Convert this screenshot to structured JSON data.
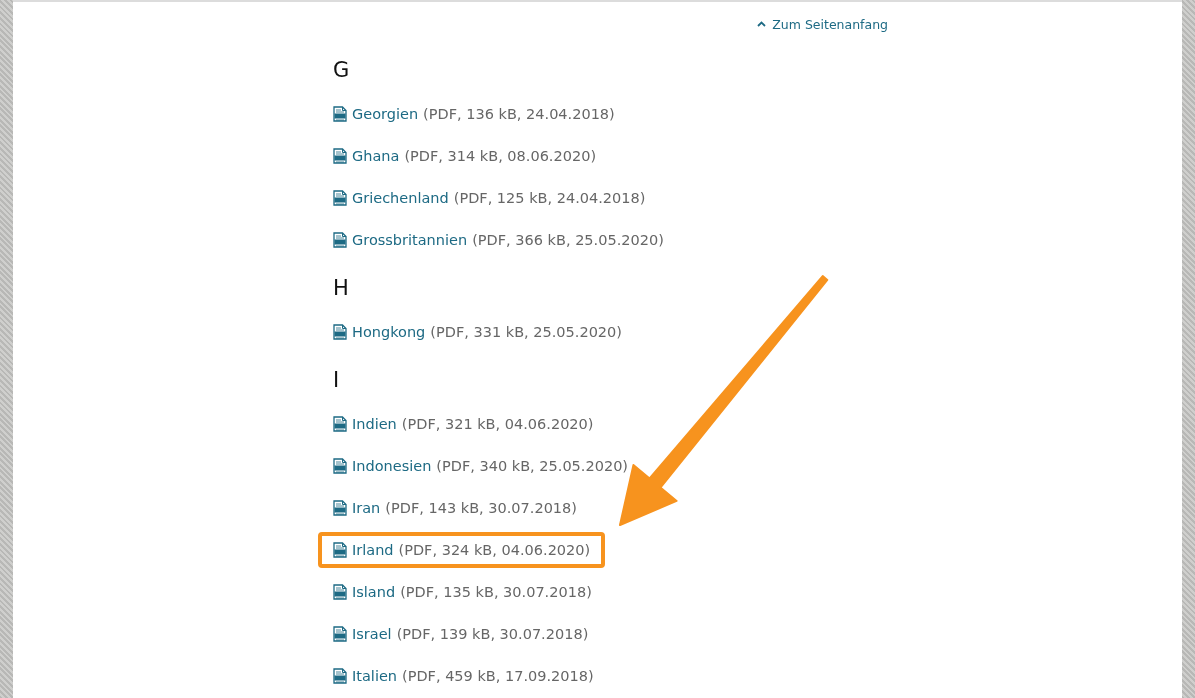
{
  "back_to_top": {
    "label": "Zum Seitenanfang"
  },
  "sections": [
    {
      "letter": "G",
      "items": [
        {
          "name": "Georgien",
          "info": "(PDF, 136 kB, 24.04.2018)",
          "highlighted": false
        },
        {
          "name": "Ghana",
          "info": "(PDF, 314 kB, 08.06.2020)",
          "highlighted": false
        },
        {
          "name": "Griechenland",
          "info": "(PDF, 125 kB, 24.04.2018)",
          "highlighted": false
        },
        {
          "name": "Grossbritannien",
          "info": "(PDF, 366 kB, 25.05.2020)",
          "highlighted": false
        }
      ]
    },
    {
      "letter": "H",
      "items": [
        {
          "name": "Hongkong",
          "info": "(PDF, 331 kB, 25.05.2020)",
          "highlighted": false
        }
      ]
    },
    {
      "letter": "I",
      "items": [
        {
          "name": "Indien",
          "info": "(PDF, 321 kB, 04.06.2020)",
          "highlighted": false
        },
        {
          "name": "Indonesien",
          "info": "(PDF, 340 kB, 25.05.2020)",
          "highlighted": false
        },
        {
          "name": "Iran",
          "info": "(PDF, 143 kB, 30.07.2018)",
          "highlighted": false
        },
        {
          "name": "Irland",
          "info": "(PDF, 324 kB, 04.06.2020)",
          "highlighted": true
        },
        {
          "name": "Island",
          "info": "(PDF, 135 kB, 30.07.2018)",
          "highlighted": false
        },
        {
          "name": "Israel",
          "info": "(PDF, 139 kB, 30.07.2018)",
          "highlighted": false
        },
        {
          "name": "Italien",
          "info": "(PDF, 459 kB, 17.09.2018)",
          "highlighted": false
        }
      ]
    }
  ],
  "annotation": {
    "kind": "arrow"
  }
}
